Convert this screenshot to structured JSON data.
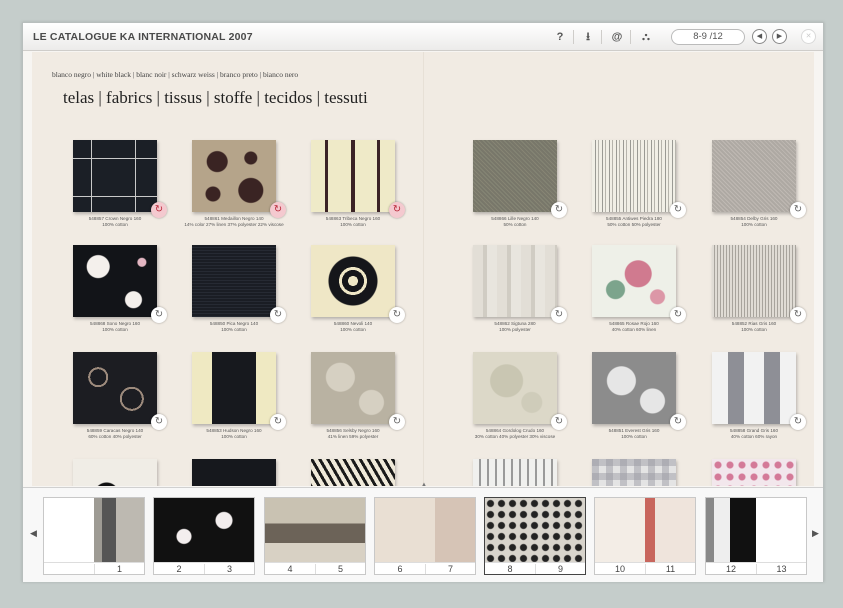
{
  "app": {
    "title": "LE CATALOGUE KA INTERNATIONAL 2007"
  },
  "toolbar": {
    "help_glyph": "?",
    "download_glyph": "⭳",
    "email_glyph": "@",
    "sitemap_glyph": "⛬",
    "page_indicator": "8-9 /12",
    "prev_glyph": "◀",
    "next_glyph": "▶",
    "close_glyph": "✕"
  },
  "page": {
    "subtitle": "blanco negro | white black | blanc noir | schwarz weiss | branco preto | bianco nero",
    "heading": "telas | fabrics | tissus | stoffe | tecidos | tessuti",
    "refresh_glyph": "↻",
    "swatches": [
      {
        "caption1": "548857 Crown Negro 160",
        "caption2": "100% cotton",
        "highlight": true
      },
      {
        "caption1": "548861 Medaillon Negro 140",
        "caption2": "14% color 27% linen 37% polyester 22% viscose",
        "highlight": true
      },
      {
        "caption1": "548863 Tribeca Negro 160",
        "caption2": "100% cotton",
        "highlight": true
      },
      {
        "caption1": "548866 Lille Negro 140",
        "caption2": "50% cotton",
        "highlight": false
      },
      {
        "caption1": "548855 Antiwes Piedra 180",
        "caption2": "50% cotton 50% polyester",
        "highlight": false
      },
      {
        "caption1": "548854 Delby Gris 160",
        "caption2": "100% cotton",
        "highlight": false
      },
      {
        "caption1": "548868 Sono Negro 160",
        "caption2": "100% cotton",
        "highlight": false
      },
      {
        "caption1": "548850 Pica Negro 140",
        "caption2": "100% cotton",
        "highlight": false
      },
      {
        "caption1": "548860 Nevoli 140",
        "caption2": "100% cotton",
        "highlight": false
      },
      {
        "caption1": "548862 Sigtuna 280",
        "caption2": "100% polyester",
        "highlight": false
      },
      {
        "caption1": "548865 Rosae Rojo 160",
        "caption2": "40% cotton 60% linen",
        "highlight": false
      },
      {
        "caption1": "548852 Rias Gris 160",
        "caption2": "100% cotton",
        "highlight": false
      },
      {
        "caption1": "548859 Caracas Negro 140",
        "caption2": "60% cotton 40% polyester",
        "highlight": false
      },
      {
        "caption1": "548853 Hudson Negro 160",
        "caption2": "100% cotton",
        "highlight": false
      },
      {
        "caption1": "548856 Selsby Negro 160",
        "caption2": "41% linen 59% polyester",
        "highlight": false
      },
      {
        "caption1": "548864 Gordolog Crudo 160",
        "caption2": "30% cotton 40% polyester 30% viscose",
        "highlight": false
      },
      {
        "caption1": "548851 Everest Gris 160",
        "caption2": "100% cotton",
        "highlight": false
      },
      {
        "caption1": "548858 Grand Gris 160",
        "caption2": "40% cotton 60% rayon",
        "highlight": false
      }
    ]
  },
  "thumbnails": {
    "strip_arrow": "▲",
    "left_glyph": "◀",
    "right_glyph": "▶",
    "items": [
      {
        "left": "",
        "right": "1"
      },
      {
        "left": "2",
        "right": "3"
      },
      {
        "left": "4",
        "right": "5"
      },
      {
        "left": "6",
        "right": "7"
      },
      {
        "left": "8",
        "right": "9"
      },
      {
        "left": "10",
        "right": "11"
      },
      {
        "left": "12",
        "right": "13"
      }
    ]
  }
}
